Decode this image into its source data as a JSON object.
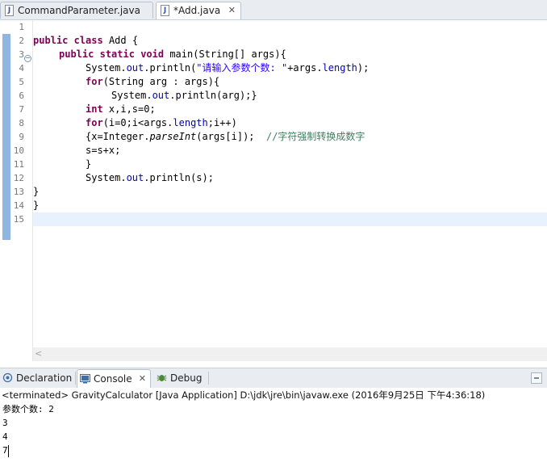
{
  "editor_tabs": [
    {
      "label": "CommandParameter.java",
      "icon": "java-file-icon",
      "active": false
    },
    {
      "label": "*Add.java",
      "icon": "java-file-icon",
      "active": true,
      "close": "✕"
    }
  ],
  "code_lines": [
    {
      "num": "1"
    },
    {
      "num": "2"
    },
    {
      "num": "3"
    },
    {
      "num": "4"
    },
    {
      "num": "5"
    },
    {
      "num": "6"
    },
    {
      "num": "7"
    },
    {
      "num": "8"
    },
    {
      "num": "9"
    },
    {
      "num": "10"
    },
    {
      "num": "11"
    },
    {
      "num": "12"
    },
    {
      "num": "13"
    },
    {
      "num": "14"
    },
    {
      "num": "15"
    }
  ],
  "code": {
    "l2": {
      "kw1": "public",
      "kw2": "class",
      "rest": " Add {"
    },
    "l3": {
      "kw1": "public",
      "kw2": "static",
      "kw3": "void",
      "rest": " main(String[] args){"
    },
    "l4": {
      "a": "System.",
      "fld": "out",
      "b": ".println(",
      "str": "\"请输入参数个数: \"",
      "c": "+args.",
      "fld2": "length",
      "d": ");"
    },
    "l5": {
      "kw": "for",
      "rest": "(String arg : args){"
    },
    "l6": {
      "a": "System.",
      "fld": "out",
      "b": ".println(arg);}"
    },
    "l7": {
      "kw": "int",
      "rest": " x,i,s=0;"
    },
    "l8": {
      "kw": "for",
      "a": "(i=0;i<args.",
      "fld": "length",
      "b": ";i++)"
    },
    "l9": {
      "a": "{x=Integer.",
      "sm": "parseInt",
      "b": "(args[i]);  ",
      "cmt": "//字符强制转换成数字"
    },
    "l10": {
      "rest": "s=s+x;"
    },
    "l11": {
      "rest": "}"
    },
    "l12": {
      "a": "System.",
      "fld": "out",
      "b": ".println(s);"
    },
    "l13": {
      "rest": "}"
    },
    "l14": {
      "rest": "}"
    }
  },
  "panel_tabs": [
    {
      "label": "Declaration",
      "icon": "declaration-icon",
      "active": false
    },
    {
      "label": "Console",
      "icon": "console-icon",
      "active": true,
      "close": "✕"
    },
    {
      "label": "Debug",
      "icon": "debug-icon",
      "active": false
    }
  ],
  "console": {
    "header": "<terminated> GravityCalculator [Java Application] D:\\jdk\\jre\\bin\\javaw.exe (2016年9月25日 下午4:36:18)",
    "lines": [
      "参数个数: 2",
      "3",
      "4",
      "7"
    ]
  },
  "colors": {
    "keyword": "#7f0055",
    "field": "#0000c0",
    "string": "#2a00ff",
    "comment": "#3f7f5f",
    "current_line": "#e8f2fe"
  }
}
